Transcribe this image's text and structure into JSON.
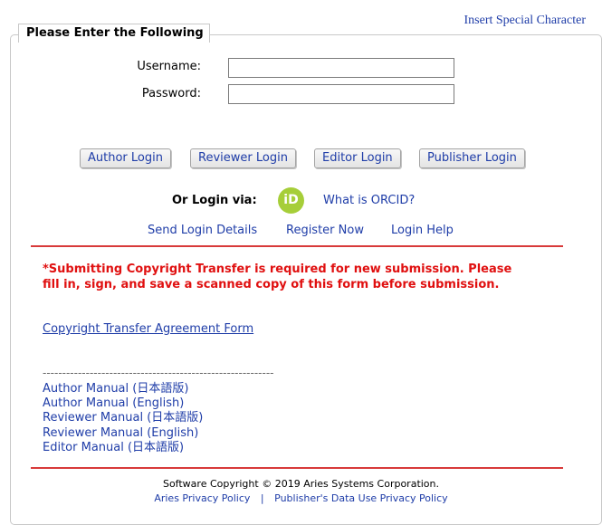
{
  "header": {
    "special_char_link": "Insert Special Character"
  },
  "form": {
    "legend": "Please Enter the Following",
    "username_label": "Username:",
    "password_label": "Password:",
    "username_value": "",
    "password_value": ""
  },
  "buttons": {
    "author": "Author Login",
    "reviewer": "Reviewer Login",
    "editor": "Editor Login",
    "publisher": "Publisher Login"
  },
  "orcid": {
    "prefix": "Or Login via:",
    "badge": "iD",
    "link": "What is ORCID?"
  },
  "links": {
    "send_login": "Send Login Details",
    "register": "Register Now",
    "help": "Login Help"
  },
  "notice": {
    "line1": "*Submitting Copyright Transfer is required for new submission. Please",
    "line2": "fill in, sign, and save a scanned copy of this form before submission."
  },
  "copyright_form_link": "Copyright Transfer Agreement Form",
  "divider_dashes": "-----------------------------------------------------------",
  "manuals": [
    "Author Manual (日本語版)",
    "Author Manual (English)",
    "Reviewer Manual (日本語版)",
    "Reviewer Manual (English)",
    "Editor Manual  (日本語版)"
  ],
  "footer": {
    "copyright": "Software Copyright © 2019 Aries Systems Corporation.",
    "privacy": "Aries Privacy Policy",
    "separator": "|",
    "data_use": "Publisher's Data Use Privacy Policy"
  },
  "colors": {
    "link": "#1f3da8",
    "warning": "#e01010",
    "rule": "#d83a3a"
  }
}
